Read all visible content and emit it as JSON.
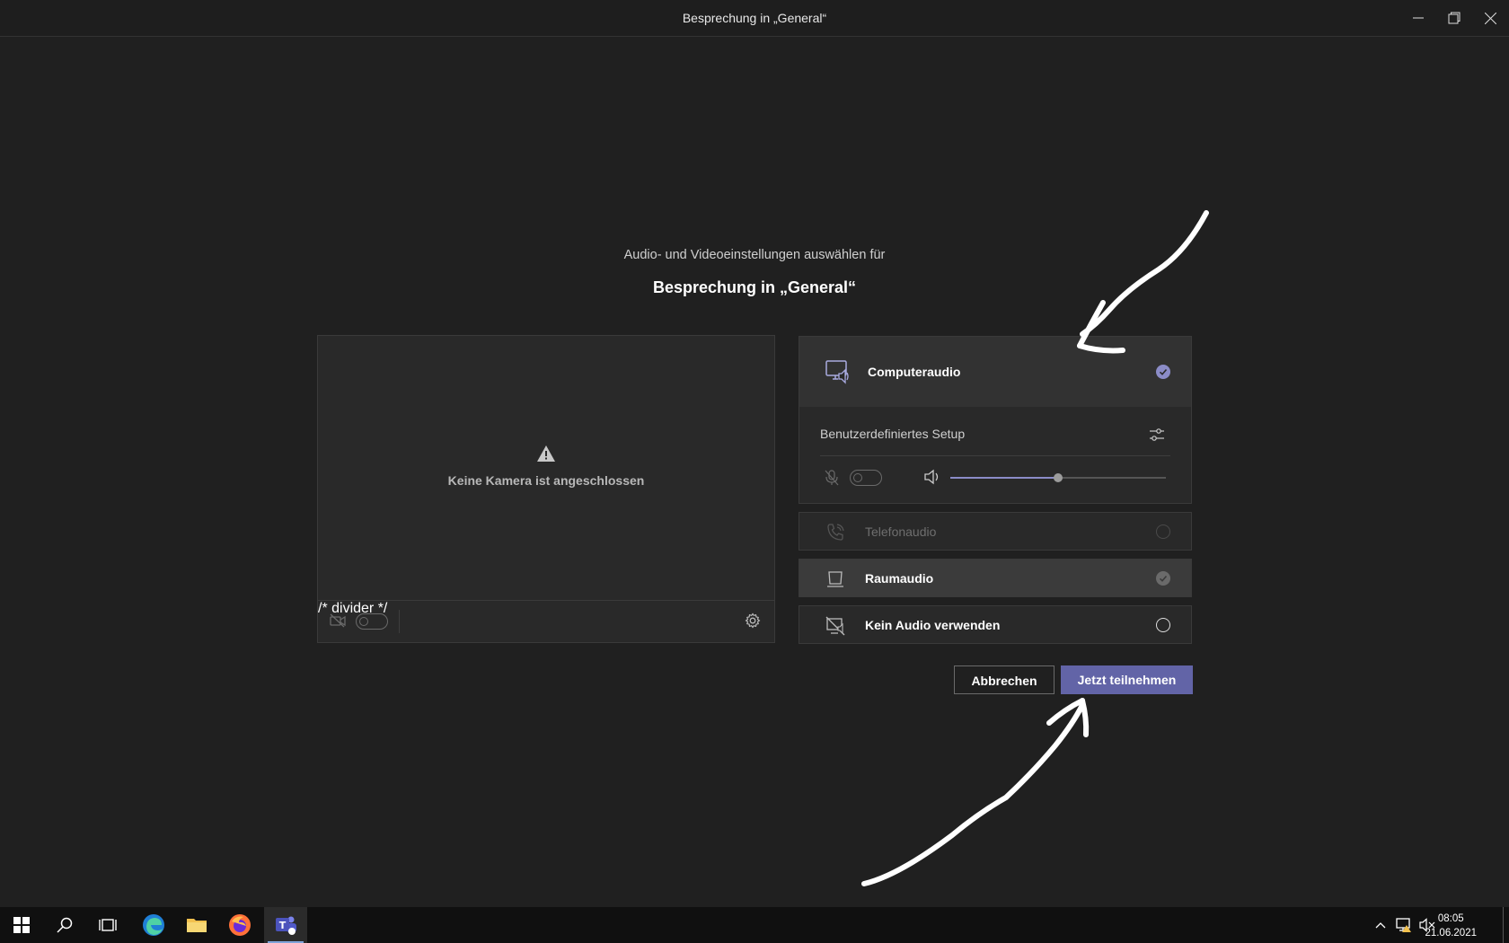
{
  "window": {
    "title": "Besprechung in „General“"
  },
  "prejoin": {
    "subtitle": "Audio- und Videoeinstellungen auswählen für",
    "meeting_title": "Besprechung in „General“",
    "video": {
      "no_camera_text": "Keine Kamera ist angeschlossen"
    },
    "audio_options": {
      "computer": {
        "label": "Computeraudio",
        "selected": true
      },
      "custom_setup_label": "Benutzerdefiniertes Setup",
      "speaker_volume": 0.5,
      "phone": {
        "label": "Telefonaudio"
      },
      "room": {
        "label": "Raumaudio"
      },
      "none": {
        "label": "Kein Audio verwenden"
      }
    },
    "buttons": {
      "cancel": "Abbrechen",
      "join": "Jetzt teilnehmen"
    }
  },
  "colors": {
    "accent": "#6264a7",
    "background": "#202020",
    "card": "#292929"
  },
  "taskbar": {
    "time": "08:05",
    "date": "21.06.2021",
    "apps": [
      "start-icon",
      "search-icon",
      "task-view-icon",
      "edge-icon",
      "file-explorer-icon",
      "firefox-icon",
      "teams-icon"
    ]
  }
}
